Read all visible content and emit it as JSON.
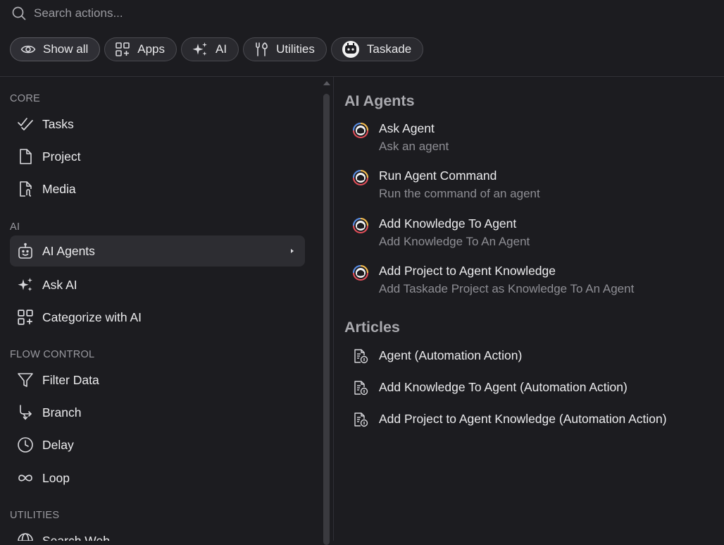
{
  "search": {
    "placeholder": "Search actions..."
  },
  "chips": {
    "show_all": "Show all",
    "apps": "Apps",
    "ai": "AI",
    "utilities": "Utilities",
    "taskade": "Taskade"
  },
  "sidebar": {
    "sections": {
      "core": "CORE",
      "ai": "AI",
      "flow": "FLOW CONTROL",
      "utilities": "UTILITIES"
    },
    "items": {
      "tasks": "Tasks",
      "project": "Project",
      "media": "Media",
      "ai_agents": "AI Agents",
      "ask_ai": "Ask AI",
      "categorize": "Categorize with AI",
      "filter": "Filter Data",
      "branch": "Branch",
      "delay": "Delay",
      "loop": "Loop",
      "search_web": "Search Web"
    },
    "selected": "ai_agents"
  },
  "main": {
    "agents_title": "AI Agents",
    "agents": [
      {
        "title": "Ask Agent",
        "subtitle": "Ask an agent"
      },
      {
        "title": "Run Agent Command",
        "subtitle": "Run the command of an agent"
      },
      {
        "title": "Add Knowledge To Agent",
        "subtitle": "Add Knowledge To An Agent"
      },
      {
        "title": "Add Project to Agent Knowledge",
        "subtitle": "Add Taskade Project as Knowledge To An Agent"
      }
    ],
    "articles_title": "Articles",
    "articles": [
      {
        "title": "Agent (Automation Action)"
      },
      {
        "title": "Add Knowledge To Agent (Automation Action)"
      },
      {
        "title": "Add Project to Agent Knowledge (Automation Action)"
      }
    ]
  },
  "colors": {
    "background": "#1c1c20",
    "selected_row": "#2d2d32",
    "avatar_ring_red": "#e8505b",
    "avatar_ring_yellow": "#f2c14e",
    "avatar_ring_blue": "#4f8fe8"
  }
}
